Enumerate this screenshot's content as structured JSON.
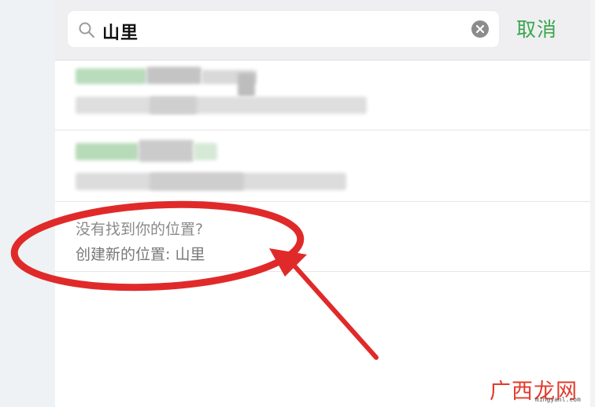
{
  "search": {
    "query": "山里",
    "cancel_label": "取消"
  },
  "results": {
    "not_found": "没有找到你的位置?",
    "create_new": "创建新的位置:  山里"
  },
  "watermark": {
    "site": "广西龙网",
    "url": "mingyanl.com"
  },
  "colors": {
    "accent_green": "#3aa64f",
    "annotation_red": "#e02a2a"
  }
}
